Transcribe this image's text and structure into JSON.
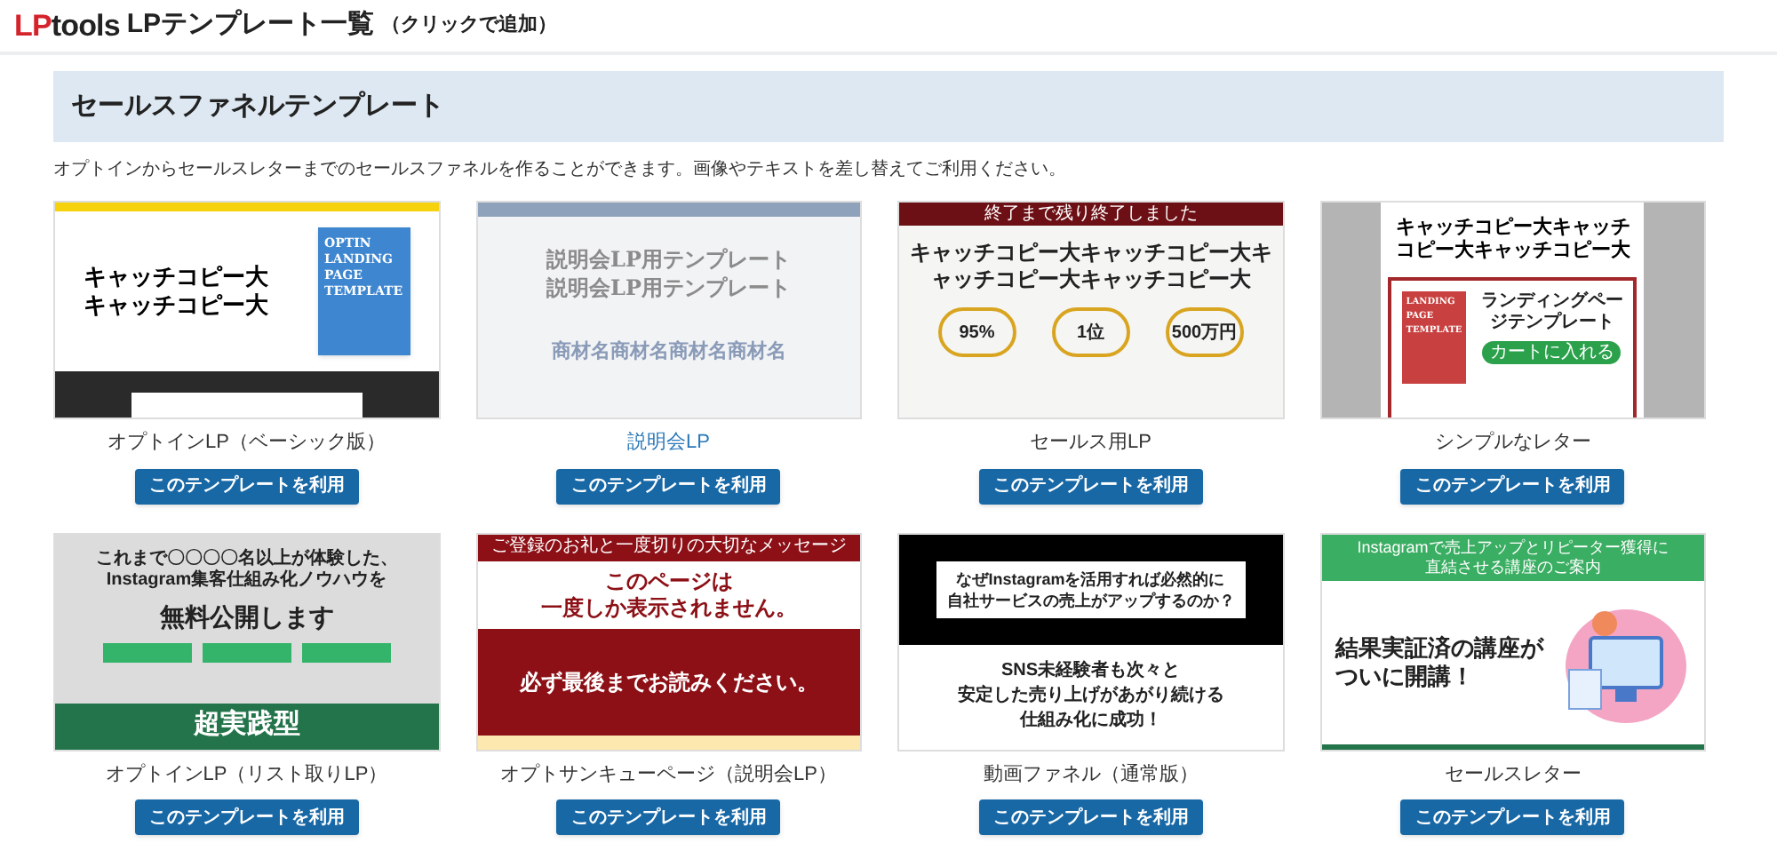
{
  "header": {
    "logo_prefix": "LP",
    "logo_suffix": "tools",
    "title": "LPテンプレート一覧",
    "title_note": "（クリックで追加）"
  },
  "section": {
    "heading": "セールスファネルテンプレート",
    "description": "オプトインからセールスレターまでのセールスファネルを作ることができます。画像やテキストを差し替えてご利用ください。"
  },
  "templates": [
    {
      "name": "オプトインLP（ベーシック版）",
      "active": false,
      "button": "このテンプレートを利用",
      "preview": {
        "kind": "optin",
        "texts": [
          "キャッチコピー大",
          "キャッチコピー大",
          "OPTIN LANDING PAGE TEMPLATE"
        ]
      }
    },
    {
      "name": "説明会LP",
      "active": true,
      "button": "このテンプレートを利用",
      "preview": {
        "kind": "seminar",
        "texts": [
          "説明会LP用テンプレート",
          "説明会LP用テンプレート",
          "商材名商材名商材名商材名"
        ]
      }
    },
    {
      "name": "セールス用LP",
      "active": false,
      "button": "このテンプレートを利用",
      "preview": {
        "kind": "sales",
        "texts": [
          "終了まで残り終了しました",
          "キャッチコピー大キャッチコピー大キャッチコピー大キャッチコピー大",
          "95%",
          "1位",
          "500万円"
        ]
      }
    },
    {
      "name": "シンプルなレター",
      "active": false,
      "button": "このテンプレートを利用",
      "preview": {
        "kind": "letter",
        "texts": [
          "キャッチコピー大キャッチコピー大キャッチコピー大",
          "LANDING PAGE TEMPLATE",
          "ランディングページテンプレート",
          "カートに入れる"
        ]
      }
    },
    {
      "name": "オプトインLP（リスト取りLP）",
      "active": false,
      "button": "このテンプレートを利用",
      "preview": {
        "kind": "list",
        "texts": [
          "これまで〇〇〇〇名以上が体験した、",
          "Instagram集客仕組み化ノウハウを",
          "無料公開します",
          "超実践型"
        ]
      }
    },
    {
      "name": "オプトサンキューページ（説明会LP）",
      "active": false,
      "button": "このテンプレートを利用",
      "preview": {
        "kind": "thanks",
        "texts": [
          "ご登録のお礼と一度切りの大切なメッセージ",
          "このページは",
          "一度しか表示されません。",
          "必ず最後までお読みください。"
        ]
      }
    },
    {
      "name": "動画ファネル（通常版）",
      "active": false,
      "button": "このテンプレートを利用",
      "preview": {
        "kind": "video",
        "texts": [
          "なぜInstagramを活用すれば必然的に",
          "自社サービスの売上がアップするのか？",
          "SNS未経験者も次々と",
          "安定した売り上げがあがり続ける",
          "仕組み化に成功！"
        ]
      }
    },
    {
      "name": "セールスレター",
      "active": false,
      "button": "このテンプレートを利用",
      "preview": {
        "kind": "salesletter",
        "texts": [
          "Instagramで売上アップとリピーター獲得に",
          "直結させる講座のご案内",
          "結果実証済の講座が",
          "ついに開講！"
        ]
      }
    }
  ]
}
